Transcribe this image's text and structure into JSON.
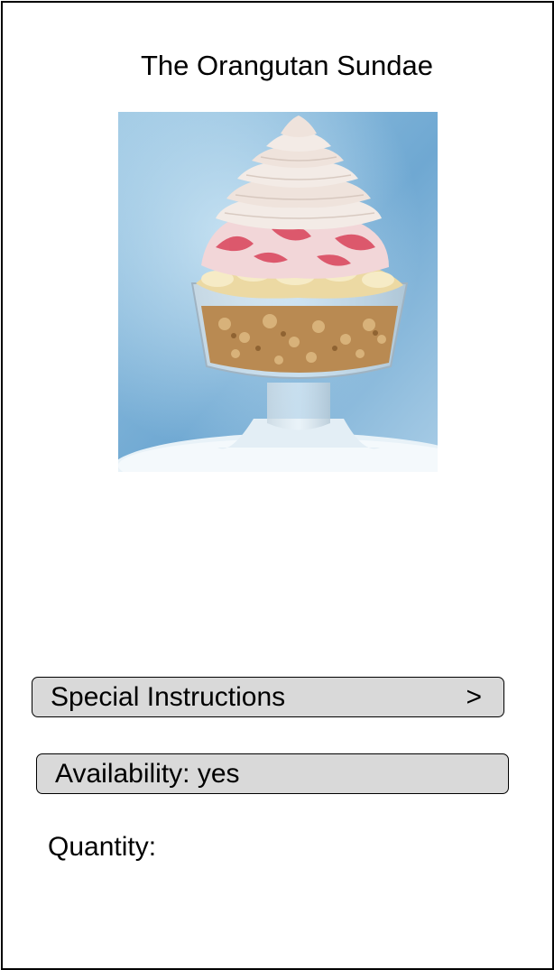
{
  "product": {
    "title": "The Orangutan Sundae",
    "image_alt": "Orangutan Sundae in a glass dish"
  },
  "options": {
    "special_instructions_label": "Special Instructions",
    "special_instructions_chevron": ">",
    "availability_label": "Availability: yes",
    "quantity_label": "Quantity:"
  },
  "colors": {
    "row_background": "#d9d9d9",
    "border": "#000000",
    "image_background": "#7fb4d6"
  }
}
